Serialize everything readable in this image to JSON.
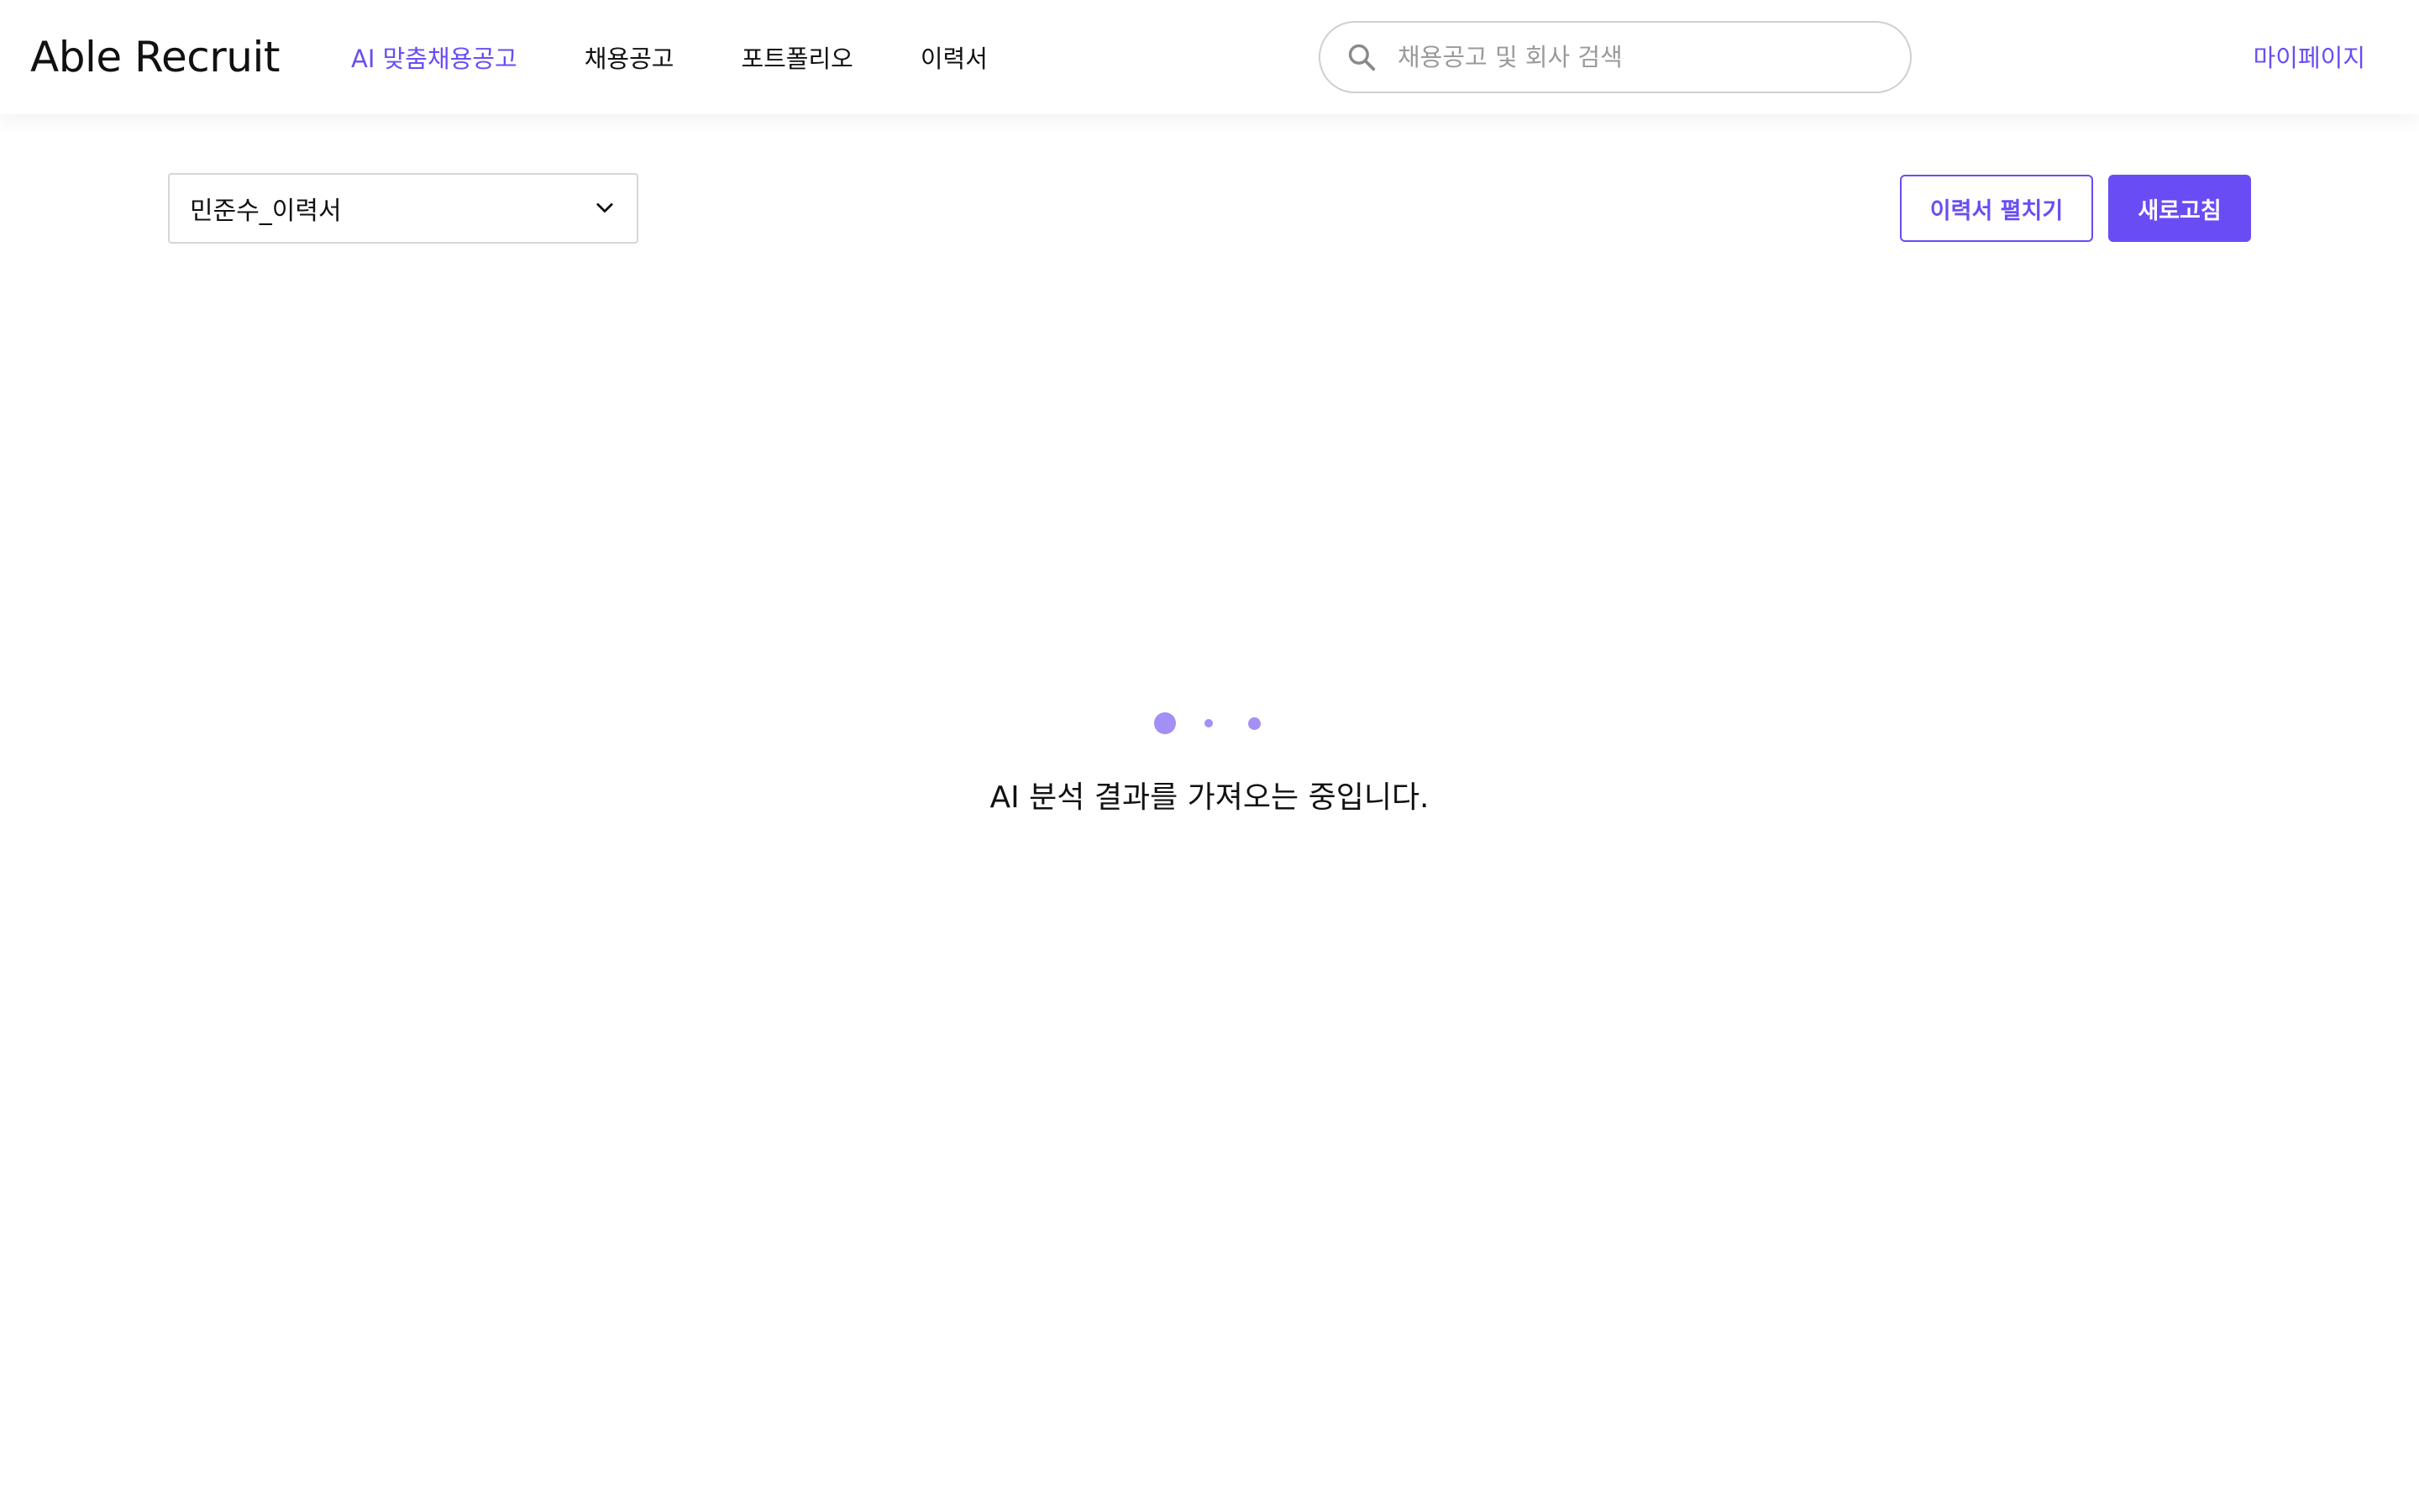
{
  "loading_progress": 0.25,
  "header": {
    "logo": "Able Recruit",
    "nav": [
      {
        "label": "AI 맞춤채용공고",
        "active": true
      },
      {
        "label": "채용공고",
        "active": false
      },
      {
        "label": "포트폴리오",
        "active": false
      },
      {
        "label": "이력서",
        "active": false
      }
    ],
    "search": {
      "placeholder": "채용공고 및 회사 검색",
      "value": ""
    },
    "mypage_label": "마이페이지"
  },
  "toolbar": {
    "resume_select_value": "민준수_이력서",
    "expand_resume_label": "이력서 펼치기",
    "refresh_label": "새로고침"
  },
  "loading": {
    "message": "AI 분석 결과를 가져오는 중입니다."
  },
  "colors": {
    "accent": "#6a4cf5",
    "dot": "#a38ff5",
    "progress": "#1f6fc8"
  }
}
